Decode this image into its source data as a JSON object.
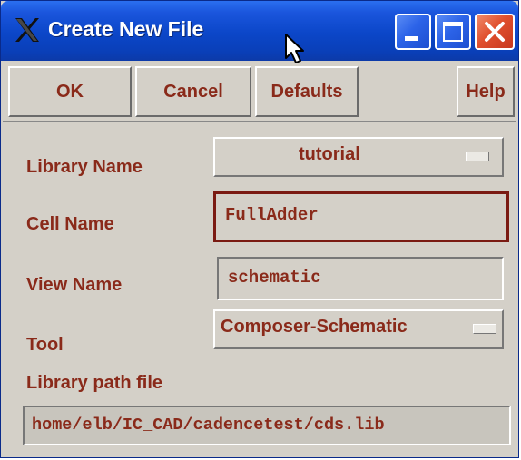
{
  "window": {
    "title": "Create New File",
    "controls": {
      "minimize": "minimize",
      "maximize": "maximize",
      "close": "close"
    }
  },
  "buttons": {
    "ok": "OK",
    "cancel": "Cancel",
    "defaults": "Defaults",
    "help": "Help"
  },
  "form": {
    "library_name_label": "Library Name",
    "library_name_value": "tutorial",
    "cell_name_label": "Cell Name",
    "cell_name_value": "FullAdder",
    "view_name_label": "View Name",
    "view_name_value": "schematic",
    "tool_label": "Tool",
    "tool_value": "Composer-Schematic",
    "library_path_label": "Library path file",
    "library_path_value": "home/elb/IC_CAD/cadencetest/cds.lib"
  },
  "colors": {
    "label_text": "#8a2a1a",
    "dialog_bg": "#d4d0c8",
    "titlebar": "#0b46c8",
    "focus_border": "#7a1a12"
  },
  "icons": [
    "x-logo-icon",
    "mouse-cursor-icon",
    "minimize-icon",
    "maximize-icon",
    "close-icon",
    "dropdown-indicator-icon"
  ]
}
